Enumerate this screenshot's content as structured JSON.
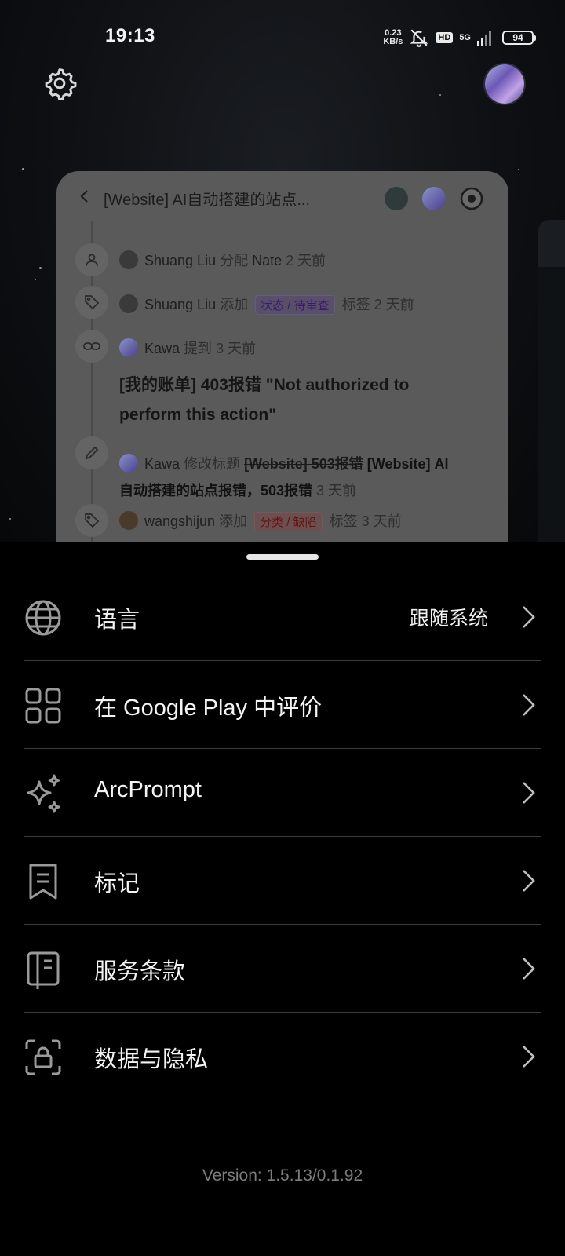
{
  "status_bar": {
    "time": "19:13",
    "net_speed_top": "0.23",
    "net_speed_bottom": "KB/s",
    "hd": "HD",
    "network": "5G",
    "battery": "94"
  },
  "preview": {
    "title": "[Website] AI自动搭建的站点...",
    "activity": [
      {
        "icon": "person-icon",
        "user": "Shuang Liu",
        "action": "分配",
        "target": "Nate",
        "time": "2 天前"
      },
      {
        "icon": "tag-icon",
        "user": "Shuang Liu",
        "action": "添加",
        "tag": "状态 / 待审查",
        "suffix": "标签",
        "time": "2 天前"
      },
      {
        "icon": "link-icon",
        "user": "Kawa",
        "action": "提到",
        "time": "3 天前",
        "issue": "[我的账单] 403报错 \"Not authorized to perform this action\""
      },
      {
        "icon": "pencil-icon",
        "user": "Kawa",
        "action": "修改标题",
        "old_title": "[Website] 503报错",
        "new_title_a": "[Website] AI",
        "new_title_b": "自动搭建的站点报错，503报错",
        "time": "3 天前"
      },
      {
        "icon": "tag-icon",
        "user": "wangshijun",
        "action": "添加",
        "tag": "分类 / 缺陷",
        "suffix": "标签",
        "time": "3 天前"
      }
    ]
  },
  "menu": [
    {
      "icon": "globe-icon",
      "label": "语言",
      "value": "跟随系统"
    },
    {
      "icon": "grid-icon",
      "label": "在 Google Play 中评价"
    },
    {
      "icon": "sparkle-icon",
      "label": "ArcPrompt"
    },
    {
      "icon": "bookmark-icon",
      "label": "标记"
    },
    {
      "icon": "book-icon",
      "label": "服务条款"
    },
    {
      "icon": "lock-icon",
      "label": "数据与隐私"
    }
  ],
  "version": "Version: 1.5.13/0.1.92"
}
